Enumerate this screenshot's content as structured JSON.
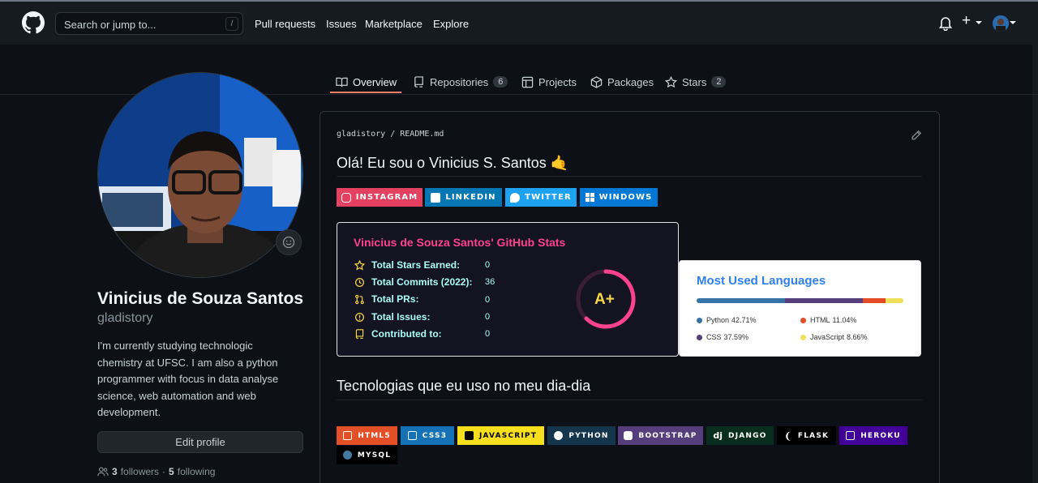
{
  "header": {
    "search_placeholder": "Search or jump to...",
    "search_shortcut": "/",
    "nav": [
      "Pull requests",
      "Issues",
      "Marketplace",
      "Explore"
    ],
    "plus_label": "+"
  },
  "tabs": [
    {
      "label": "Overview",
      "icon": "book-icon",
      "count": null,
      "selected": true
    },
    {
      "label": "Repositories",
      "icon": "repo-icon",
      "count": "6"
    },
    {
      "label": "Projects",
      "icon": "project-icon",
      "count": null
    },
    {
      "label": "Packages",
      "icon": "package-icon",
      "count": null
    },
    {
      "label": "Stars",
      "icon": "star-icon",
      "count": "2"
    }
  ],
  "profile": {
    "name": "Vinicius de Souza Santos",
    "login": "gladistory",
    "bio": "I'm currently studying technologic chemistry at UFSC. I am also a python programmer with focus in data analyse science, web automation and web development.",
    "edit_label": "Edit profile",
    "followers_count": "3",
    "followers_label": "followers",
    "separator": "·",
    "following_count": "5",
    "following_label": "following"
  },
  "readme": {
    "path": "gladistory / README.md",
    "heading": "Olá! Eu sou o Vinicius S. Santos 🤙",
    "social_badges": [
      {
        "label": "INSTAGRAM",
        "color": "#e4405f"
      },
      {
        "label": "LINKEDIN",
        "color": "#0077b5"
      },
      {
        "label": "TWITTER",
        "color": "#1da1f2"
      },
      {
        "label": "WINDOWS",
        "color": "#0078d6"
      }
    ],
    "stats": {
      "title": "Vinicius de Souza Santos' GitHub Stats",
      "rows": [
        {
          "label": "Total Stars Earned:",
          "value": "0",
          "icon": "star-icon"
        },
        {
          "label": "Total Commits (2022):",
          "value": "36",
          "icon": "history-icon"
        },
        {
          "label": "Total PRs:",
          "value": "0",
          "icon": "pull-request-icon"
        },
        {
          "label": "Total Issues:",
          "value": "0",
          "icon": "issue-icon"
        },
        {
          "label": "Contributed to:",
          "value": "0",
          "icon": "repo-icon"
        }
      ],
      "rank": "A+"
    },
    "languages": {
      "title": "Most Used Languages",
      "items": [
        {
          "name": "Python",
          "percent": "42.71%",
          "value": 42.71,
          "color": "#3572a5"
        },
        {
          "name": "CSS",
          "percent": "37.59%",
          "value": 37.59,
          "color": "#563d7c"
        },
        {
          "name": "HTML",
          "percent": "11.04%",
          "value": 11.04,
          "color": "#e34c26"
        },
        {
          "name": "JavaScript",
          "percent": "8.66%",
          "value": 8.66,
          "color": "#f1e05a"
        }
      ]
    },
    "tech_heading": "Tecnologias que eu uso no meu dia-dia",
    "tech_badges": [
      {
        "label": "HTML5",
        "bg": "#e34f26",
        "fg": "#ffffff"
      },
      {
        "label": "CSS3",
        "bg": "#1572b6",
        "fg": "#ffffff"
      },
      {
        "label": "JAVASCRIPT",
        "bg": "#f7df1e",
        "fg": "#000000"
      },
      {
        "label": "PYTHON",
        "bg": "#14354c",
        "fg": "#ffffff"
      },
      {
        "label": "BOOTSTRAP",
        "bg": "#563d7c",
        "fg": "#ffffff"
      },
      {
        "label": "DJANGO",
        "bg": "#092e20",
        "fg": "#ffffff"
      },
      {
        "label": "FLASK",
        "bg": "#000000",
        "fg": "#ffffff"
      },
      {
        "label": "HEROKU",
        "bg": "#430098",
        "fg": "#ffffff"
      },
      {
        "label": "MYSQL",
        "bg": "#000000",
        "fg": "#ffffff"
      }
    ]
  }
}
